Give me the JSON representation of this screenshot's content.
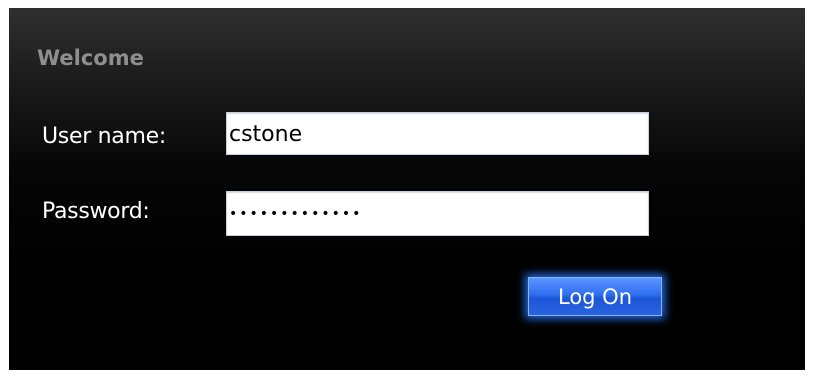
{
  "form": {
    "title": "Welcome",
    "username_label": "User name:",
    "username_value": "cstone",
    "password_label": "Password:",
    "password_value": "•••••••••••••",
    "logon_label": "Log On"
  },
  "colors": {
    "panel_background": "#000000",
    "title_text": "#8f8f8f",
    "label_text": "#ffffff",
    "button_accent": "#2f6ff0"
  }
}
